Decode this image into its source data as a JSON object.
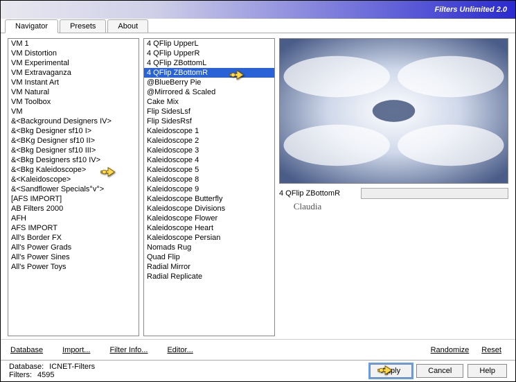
{
  "title": "Filters Unlimited 2.0",
  "tabs": [
    "Navigator",
    "Presets",
    "About"
  ],
  "active_tab": 0,
  "categories": [
    "VM 1",
    "VM Distortion",
    "VM Experimental",
    "VM Extravaganza",
    "VM Instant Art",
    "VM Natural",
    "VM Toolbox",
    "VM",
    "&<Background Designers IV>",
    "&<Bkg Designer sf10 I>",
    "&<BKg Designer sf10 II>",
    "&<Bkg Designer sf10 III>",
    "&<Bkg Designers sf10 IV>",
    "&<Bkg Kaleidoscope>",
    "&<Kaleidoscope>",
    "&<Sandflower Specials°v°>",
    "[AFS IMPORT]",
    "AB Filters 2000",
    "AFH",
    "AFS IMPORT",
    "All's Border FX",
    "All's Power Grads",
    "All's Power Sines",
    "All's Power Toys"
  ],
  "category_selected": -1,
  "category_pointer_index": 13,
  "filters": [
    "4 QFlip UpperL",
    "4 QFlip UpperR",
    "4 QFlip ZBottomL",
    "4 QFlip ZBottomR",
    "@BlueBerry Pie",
    "@Mirrored & Scaled",
    "Cake Mix",
    "Flip SidesLsf",
    "Flip SidesRsf",
    "Kaleidoscope 1",
    "Kaleidoscope 2",
    "Kaleidoscope 3",
    "Kaleidoscope 4",
    "Kaleidoscope 5",
    "Kaleidoscope 8",
    "Kaleidoscope 9",
    "Kaleidoscope Butterfly",
    "Kaleidoscope Divisions",
    "Kaleidoscope Flower",
    "Kaleidoscope Heart",
    "Kaleidoscope Persian",
    "Nomads Rug",
    "Quad Flip",
    "Radial Mirror",
    "Radial Replicate"
  ],
  "filter_selected": 3,
  "filter_pointer_index": 3,
  "slider": {
    "label": "4 QFlip ZBottomR"
  },
  "actions": {
    "database": "Database",
    "import": "Import...",
    "filter_info": "Filter Info...",
    "editor": "Editor...",
    "randomize": "Randomize",
    "reset": "Reset",
    "apply": "Apply",
    "cancel": "Cancel",
    "help": "Help"
  },
  "status": {
    "db_label": "Database:",
    "db_value": "ICNET-Filters",
    "filters_label": "Filters:",
    "filters_value": "4595"
  },
  "watermark": "Claudia"
}
